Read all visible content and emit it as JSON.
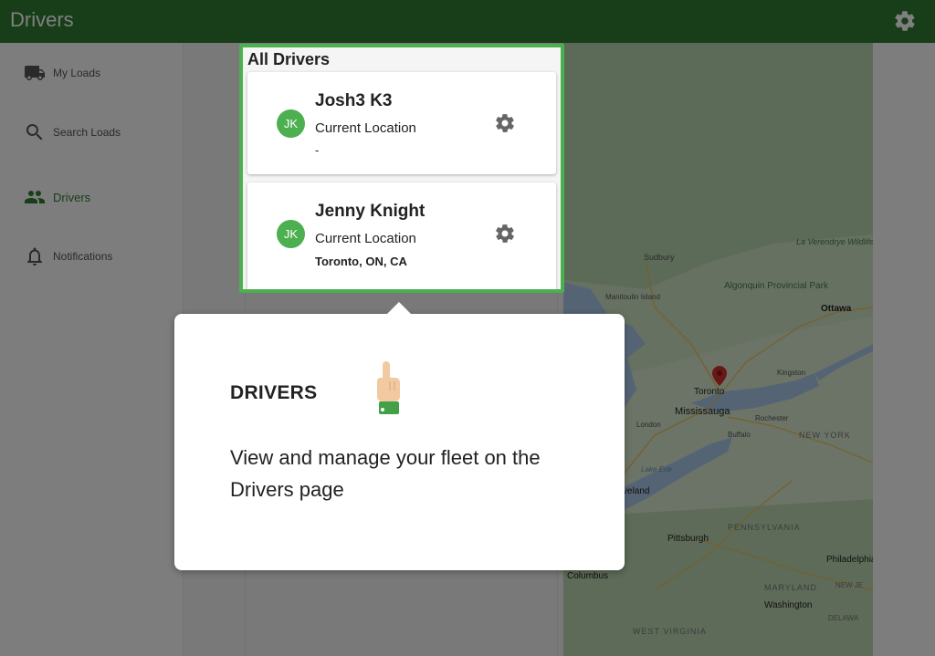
{
  "app": {
    "title": "Drivers"
  },
  "sidebar": {
    "items": [
      {
        "label": "My Loads",
        "icon": "truck-icon"
      },
      {
        "label": "Search Loads",
        "icon": "search-icon"
      },
      {
        "label": "Drivers",
        "icon": "people-icon",
        "active": true
      },
      {
        "label": "Notifications",
        "icon": "bell-icon"
      }
    ]
  },
  "drivers": {
    "header": "All Drivers",
    "list": [
      {
        "initials": "JK",
        "name": "Josh3 K3",
        "location_label": "Current Location",
        "location": "-"
      },
      {
        "initials": "JK",
        "name": "Jenny Knight",
        "location_label": "Current Location",
        "location": "Toronto, ON, CA"
      }
    ]
  },
  "map": {
    "labels": [
      "Sudbury",
      "Algonquin Provincial Park",
      "La Verendrye Wildlife Reserve",
      "Ottawa",
      "Manitoulin Island",
      "Kingston",
      "Toronto",
      "Mississauga",
      "Rochester",
      "London",
      "Buffalo",
      "NEW YORK",
      "Lake Erie",
      "Cleveland",
      "PENNSYLVANIA",
      "Pittsburgh",
      "Philadelphia",
      "NEW JE",
      "MARYLAND",
      "Washington",
      "Columbus",
      "WEST VIRGINIA",
      "DELAWA"
    ]
  },
  "tooltip": {
    "title": "DRIVERS",
    "body": "View and manage your fleet on the Drivers page"
  },
  "colors": {
    "primary": "#2e7d32",
    "accent": "#4caf50",
    "pin": "#d32f2f"
  }
}
